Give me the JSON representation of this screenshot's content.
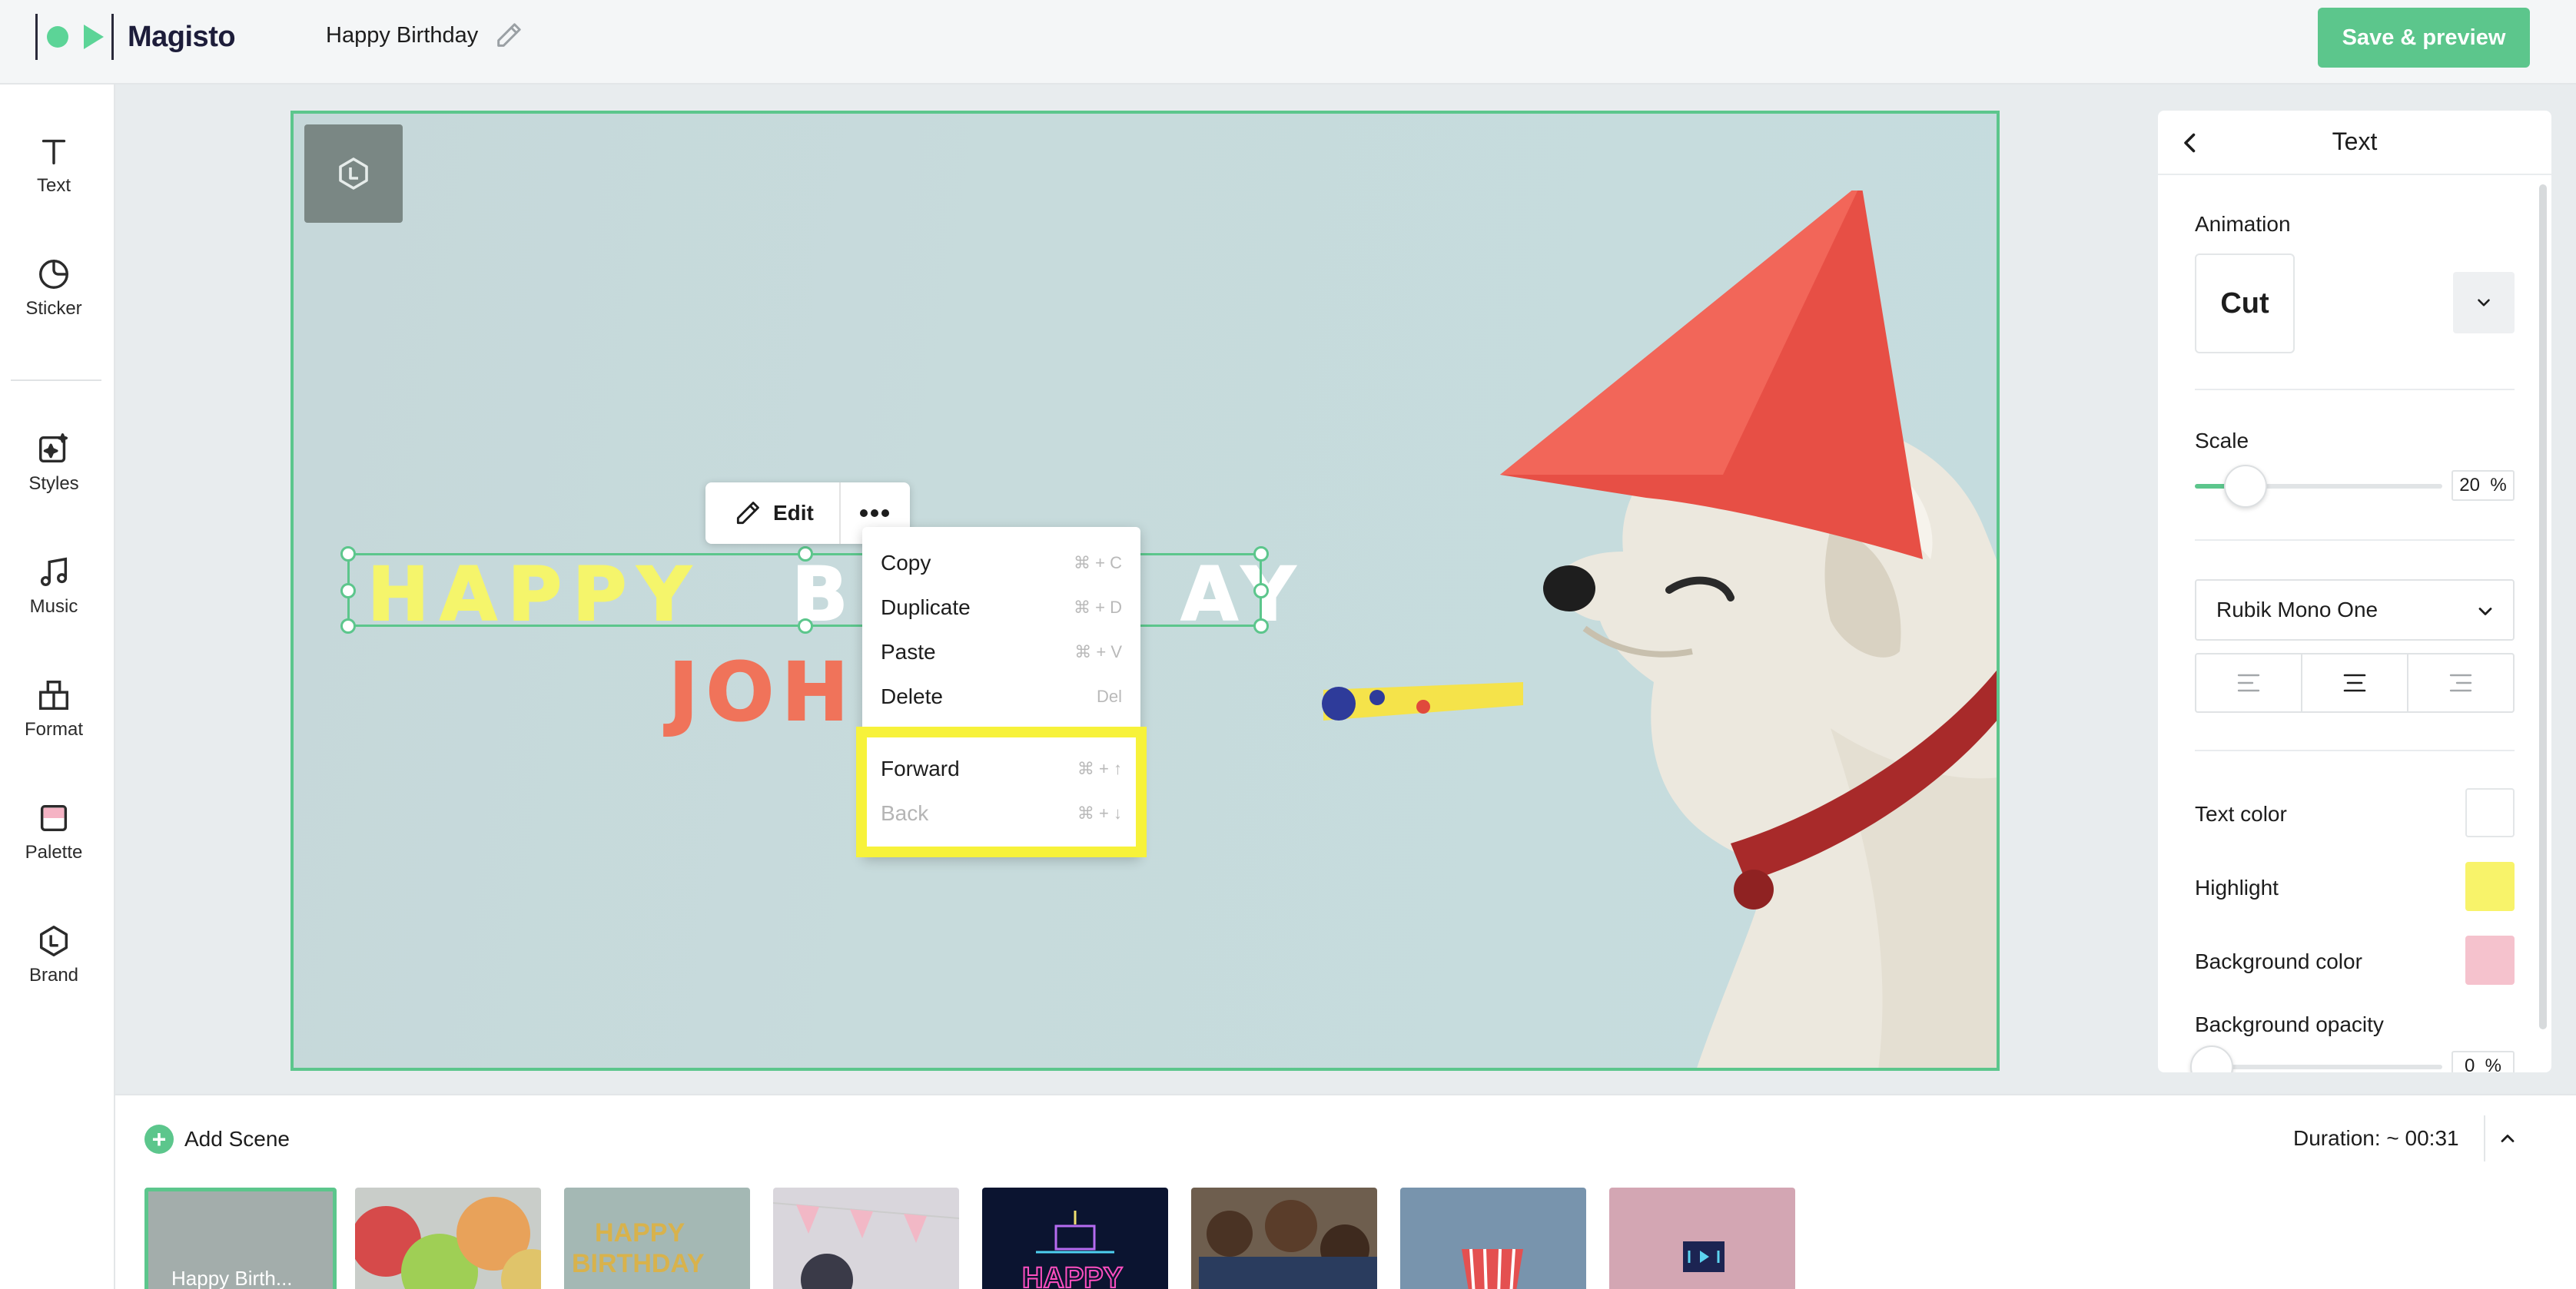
{
  "app": {
    "name": "Magisto",
    "project_title": "Happy Birthday",
    "save_label": "Save & preview"
  },
  "sidebar": {
    "items": [
      {
        "label": "Text"
      },
      {
        "label": "Sticker"
      },
      {
        "label": "Styles"
      },
      {
        "label": "Music"
      },
      {
        "label": "Format"
      },
      {
        "label": "Palette"
      },
      {
        "label": "Brand"
      }
    ]
  },
  "canvas": {
    "text_line1_a": "HAPPY",
    "text_line1_b": "BI",
    "text_line1_c": "AY",
    "text_line2": "JOH"
  },
  "toolbar": {
    "edit_label": "Edit"
  },
  "context_menu": {
    "items": [
      {
        "label": "Copy",
        "shortcut": "⌘ + C"
      },
      {
        "label": "Duplicate",
        "shortcut": "⌘ + D"
      },
      {
        "label": "Paste",
        "shortcut": "⌘ + V"
      },
      {
        "label": "Delete",
        "shortcut": "Del"
      },
      {
        "label": "Forward",
        "shortcut": "⌘ + ↑"
      },
      {
        "label": "Back",
        "shortcut": "⌘ + ↓",
        "disabled": true
      }
    ]
  },
  "panel": {
    "title": "Text",
    "animation_label": "Animation",
    "animation_value": "Cut",
    "scale_label": "Scale",
    "scale_value": "20",
    "scale_unit": "%",
    "font_value": "Rubik Mono One",
    "text_color_label": "Text color",
    "highlight_label": "Highlight",
    "bg_color_label": "Background color",
    "bg_opacity_label": "Background opacity",
    "bg_opacity_value": "0",
    "bg_opacity_unit": "%",
    "colors": {
      "text": "#ffffff",
      "highlight": "#f8f36a",
      "background": "#f5c2cd"
    }
  },
  "bottom": {
    "add_scene_label": "Add Scene",
    "duration": "Duration: ~ 00:31",
    "thumbnails": [
      {
        "caption": "Happy Birth..."
      }
    ]
  },
  "accent": "#5cc68c"
}
